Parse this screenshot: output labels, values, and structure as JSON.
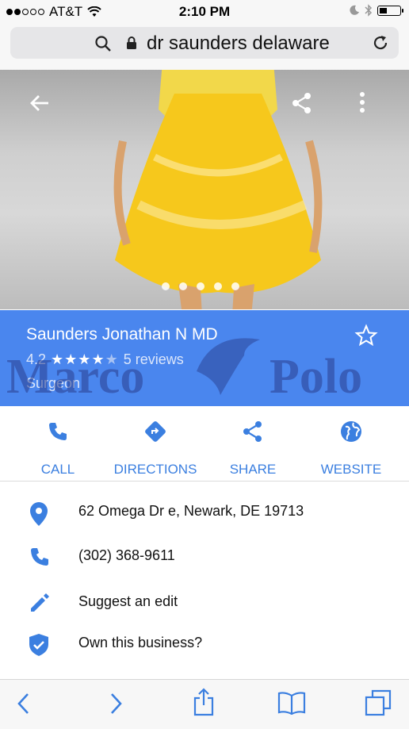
{
  "status": {
    "carrier": "AT&T",
    "time": "2:10 PM"
  },
  "browser": {
    "url_text": "dr saunders delaware"
  },
  "business": {
    "name": "Saunders Jonathan N MD",
    "rating": "4.2",
    "stars_filled": 4,
    "reviews": "5 reviews",
    "category": "Surgeon"
  },
  "watermark": {
    "left": "Marco",
    "right": "Polo"
  },
  "actions": [
    {
      "label": "CALL",
      "icon": "phone-icon"
    },
    {
      "label": "DIRECTIONS",
      "icon": "directions-icon"
    },
    {
      "label": "SHARE",
      "icon": "share-icon"
    },
    {
      "label": "WEBSITE",
      "icon": "globe-icon"
    }
  ],
  "details": [
    {
      "text": "62 Omega Dr e, Newark, DE 19713",
      "icon": "location-pin-icon"
    },
    {
      "text": "(302) 368-9611",
      "icon": "phone-icon"
    },
    {
      "text": "Suggest an edit",
      "icon": "pencil-icon"
    },
    {
      "text": "Own this business?",
      "icon": "verified-shield-icon"
    }
  ],
  "colors": {
    "accent": "#4a86ee",
    "link": "#3b7fe0"
  },
  "photo_pager": {
    "count": 5,
    "active": 0
  }
}
